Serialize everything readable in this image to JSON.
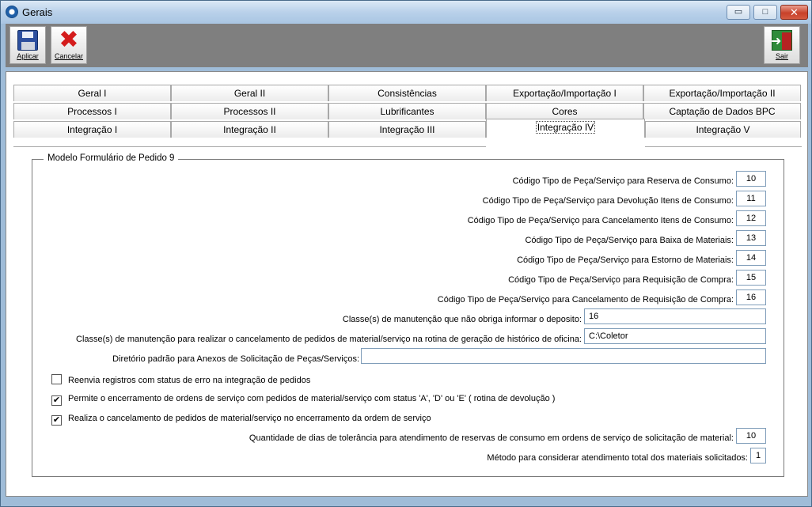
{
  "window": {
    "title": "Gerais",
    "min_label": "▭",
    "max_label": "□",
    "close_label": "✕"
  },
  "toolbar": {
    "apply_label": "Aplicar",
    "cancel_label": "Cancelar",
    "exit_label": "Sair"
  },
  "tabs": {
    "row1": [
      "Geral I",
      "Geral II",
      "Consistências",
      "Exportação/Importação I",
      "Exportação/Importação II"
    ],
    "row2": [
      "Processos I",
      "Processos II",
      "Lubrificantes",
      "Cores",
      "Captação de Dados BPC"
    ],
    "row3": [
      "Integração I",
      "Integração II",
      "Integração III",
      "Integração IV",
      "Integração V"
    ],
    "active": "Integração IV"
  },
  "group": {
    "title": "Modelo Formulário de Pedido 9",
    "fields": [
      {
        "label": "Código Tipo de Peça/Serviço para Reserva de Consumo:",
        "value": "10"
      },
      {
        "label": "Código Tipo de Peça/Serviço para Devolução Itens de Consumo:",
        "value": "11"
      },
      {
        "label": "Código Tipo de Peça/Serviço para Cancelamento Itens de Consumo:",
        "value": "12"
      },
      {
        "label": "Código Tipo de Peça/Serviço para Baixa de Materiais:",
        "value": "13"
      },
      {
        "label": "Código Tipo de Peça/Serviço para Estorno de Materiais:",
        "value": "14"
      },
      {
        "label": "Código Tipo de Peça/Serviço para Requisição de Compra:",
        "value": "15"
      },
      {
        "label": "Código Tipo de Peça/Serviço para Cancelamento de Requisição de Compra:",
        "value": "16"
      }
    ],
    "classes_deposito": {
      "label": "Classe(s) de manutenção que não obriga informar o deposito:",
      "value": "16"
    },
    "classes_cancelamento": {
      "label": "Classe(s) de manutenção para realizar o cancelamento de pedidos de material/serviço na rotina de geração de histórico de oficina:",
      "value": "C:\\Coletor"
    },
    "diretorio": {
      "label": "Diretório padrão para Anexos de Solicitação de Peças/Serviços:",
      "value": ""
    },
    "checkboxes": [
      {
        "label": "Reenvia registros com status de erro na integração de pedidos",
        "checked": false
      },
      {
        "label": "Permite o encerramento de ordens de serviço com pedidos de material/serviço com status 'A', 'D' ou 'E' ( rotina de devolução )",
        "checked": true
      },
      {
        "label": "Realiza o cancelamento de pedidos de material/serviço no encerramento da ordem de serviço",
        "checked": true
      }
    ],
    "dias_tolerancia": {
      "label": "Quantidade de dias de tolerância para atendimento de reservas de consumo em ordens de serviço de solicitação de material:",
      "value": "10"
    },
    "metodo": {
      "label": "Método para considerar atendimento total dos materiais solicitados:",
      "value": "1"
    }
  }
}
